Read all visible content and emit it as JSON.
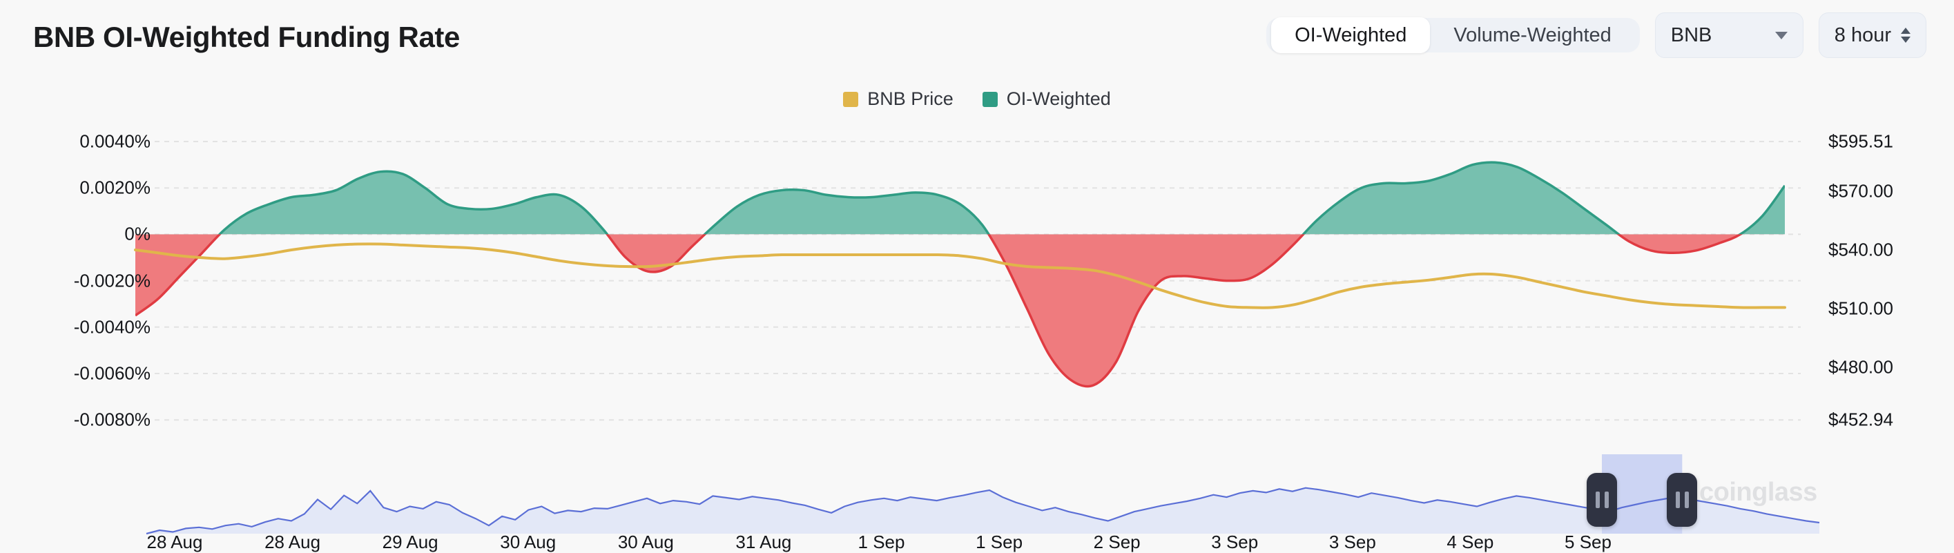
{
  "header": {
    "title": "BNB OI-Weighted Funding Rate",
    "segmented": [
      {
        "label": "OI-Weighted",
        "active": true
      },
      {
        "label": "Volume-Weighted",
        "active": false
      }
    ],
    "asset_select": {
      "value": "BNB",
      "icon": "chevron-down-icon"
    },
    "interval_stepper": {
      "value": "8 hour",
      "icon": "stepper-arrows-icon"
    }
  },
  "watermark": {
    "text": "coinglass",
    "icon": "bull-logo-icon"
  },
  "colors": {
    "price_line": "#e0b54a",
    "funding_positive": "#77c0af",
    "funding_positive_stroke": "#2f9c84",
    "funding_negative": "#ef7b7e",
    "funding_negative_stroke": "#e03b42",
    "navigator_line": "#5b6fd6",
    "navigator_fill": "#e3e8f7",
    "selection_fill": "#ccd4f3",
    "grid": "#e2e2e2",
    "background": "#f8f8f8"
  },
  "chart_data": {
    "type": "area",
    "title": "BNB OI-Weighted Funding Rate",
    "xlabel": "",
    "ylabel": "",
    "grid": true,
    "legend_position": "top-center",
    "legend": [
      "BNB Price",
      "OI-Weighted"
    ],
    "x_ticks": [
      "28 Aug",
      "28 Aug",
      "29 Aug",
      "30 Aug",
      "30 Aug",
      "31 Aug",
      "1 Sep",
      "1 Sep",
      "2 Sep",
      "3 Sep",
      "3 Sep",
      "4 Sep",
      "5 Sep"
    ],
    "y_left_ticks": [
      "0.0040%",
      "0.0020%",
      "0%",
      "-0.0020%",
      "-0.0040%",
      "-0.0060%",
      "-0.0080%"
    ],
    "y_left_values": [
      0.004,
      0.002,
      0,
      -0.002,
      -0.004,
      -0.006,
      -0.008
    ],
    "y_left_lim": [
      -0.008,
      0.004
    ],
    "y_right_ticks": [
      "$595.51",
      "$570.00",
      "$540.00",
      "$510.00",
      "$480.00",
      "$452.94"
    ],
    "y_right_values": [
      595.51,
      570.0,
      540.0,
      510.0,
      480.0,
      452.94
    ],
    "y_right_lim": [
      452.94,
      595.51
    ],
    "series": [
      {
        "name": "OI-Weighted",
        "type": "area",
        "axis": "left",
        "unit": "%",
        "values": [
          -0.0035,
          -0.0028,
          -0.0018,
          -0.0008,
          0.0002,
          0.0009,
          0.0013,
          0.0016,
          0.0017,
          0.0019,
          0.0024,
          0.0027,
          0.0026,
          0.002,
          0.0013,
          0.0011,
          0.0011,
          0.0013,
          0.0016,
          0.0017,
          0.0012,
          0.0002,
          -0.001,
          -0.0016,
          -0.0014,
          -0.0005,
          0.0004,
          0.0012,
          0.0017,
          0.0019,
          0.0019,
          0.0017,
          0.0016,
          0.0016,
          0.0017,
          0.0018,
          0.0017,
          0.0013,
          0.0004,
          -0.0012,
          -0.0032,
          -0.0052,
          -0.0063,
          -0.0065,
          -0.0055,
          -0.0033,
          -0.002,
          -0.0018,
          -0.0019,
          -0.002,
          -0.0019,
          -0.0013,
          -0.0004,
          0.0006,
          0.0014,
          0.002,
          0.0022,
          0.0022,
          0.0023,
          0.0026,
          0.003,
          0.0031,
          0.0029,
          0.0024,
          0.0018,
          0.0011,
          0.0004,
          -0.0003,
          -0.0007,
          -0.0008,
          -0.0007,
          -0.0004,
          0.0,
          0.0008,
          0.0021
        ]
      },
      {
        "name": "BNB Price",
        "type": "line",
        "axis": "right",
        "unit": "$",
        "values": [
          540.0,
          538.5,
          537.0,
          536.0,
          535.5,
          536.5,
          538.0,
          540.0,
          541.5,
          542.5,
          543.0,
          543.0,
          542.5,
          542.0,
          541.5,
          541.0,
          540.0,
          538.5,
          536.5,
          534.5,
          533.0,
          532.0,
          531.5,
          531.5,
          532.5,
          534.0,
          535.5,
          536.5,
          537.0,
          537.5,
          537.5,
          537.5,
          537.5,
          537.5,
          537.5,
          537.5,
          537.5,
          537.0,
          535.5,
          533.0,
          531.5,
          531.0,
          530.5,
          529.5,
          527.0,
          523.5,
          519.5,
          516.0,
          513.0,
          511.0,
          510.5,
          510.5,
          512.0,
          515.0,
          518.5,
          521.0,
          522.5,
          523.5,
          524.5,
          526.0,
          527.5,
          527.5,
          526.0,
          523.5,
          521.0,
          518.5,
          516.5,
          514.5,
          513.0,
          512.0,
          511.5,
          511.0,
          510.5,
          510.5,
          510.5
        ]
      }
    ]
  },
  "navigator": {
    "selection": {
      "start_pct": 87.0,
      "end_pct": 91.8
    },
    "handles": [
      {
        "name": "brush-handle-left",
        "icon": "grip-handle-icon"
      },
      {
        "name": "brush-handle-right",
        "icon": "grip-handle-icon"
      }
    ],
    "values": [
      486,
      492,
      489,
      495,
      497,
      494,
      500,
      503,
      498,
      506,
      512,
      508,
      520,
      545,
      528,
      552,
      538,
      560,
      531,
      524,
      533,
      529,
      541,
      536,
      522,
      512,
      500,
      516,
      510,
      527,
      533,
      521,
      526,
      524,
      530,
      529,
      535,
      541,
      547,
      538,
      543,
      541,
      537,
      551,
      548,
      545,
      550,
      547,
      544,
      539,
      535,
      528,
      522,
      533,
      540,
      544,
      547,
      543,
      549,
      546,
      543,
      548,
      552,
      557,
      561,
      549,
      540,
      533,
      526,
      531,
      524,
      519,
      513,
      508,
      516,
      524,
      529,
      534,
      538,
      542,
      547,
      553,
      549,
      556,
      560,
      557,
      563,
      559,
      565,
      562,
      558,
      554,
      549,
      556,
      552,
      548,
      543,
      539,
      544,
      541,
      537,
      533,
      540,
      546,
      551,
      548,
      544,
      540,
      536,
      532,
      528,
      524,
      531,
      536,
      541,
      545,
      549,
      546,
      542,
      538,
      534,
      529,
      525,
      520,
      516,
      512,
      508,
      505
    ]
  }
}
